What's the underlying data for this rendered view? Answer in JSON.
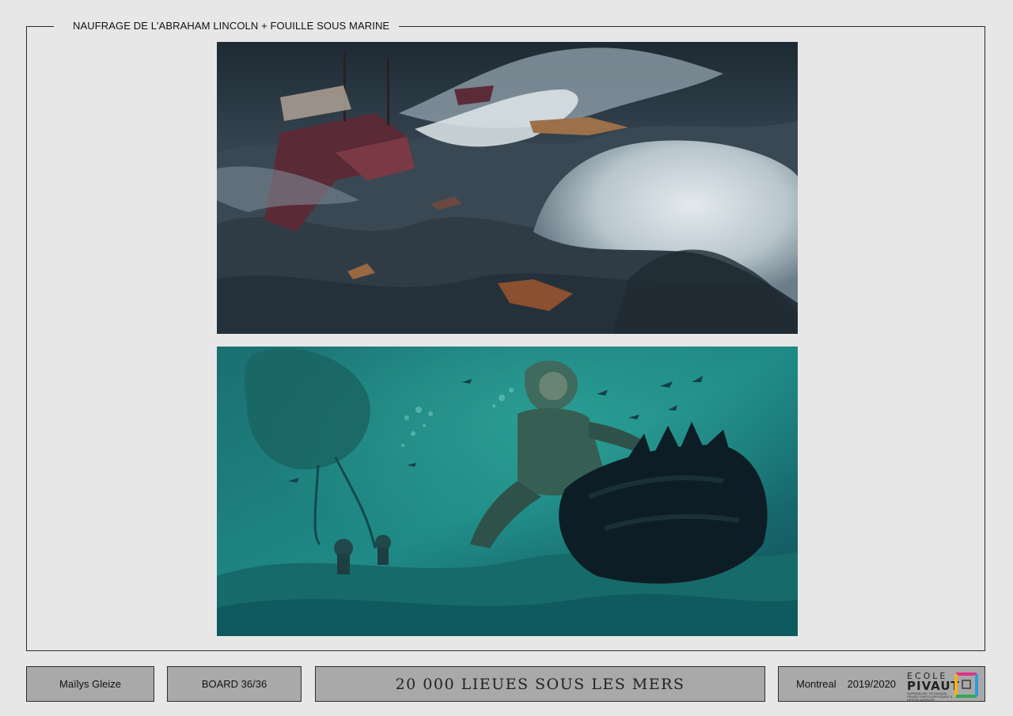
{
  "board": {
    "heading": "NAUFRAGE DE L'ABRAHAM LINCOLN + FOUILLE SOUS MARINE"
  },
  "footer": {
    "author": "Maïlys Gleize",
    "board_number": "BOARD 36/36",
    "project_title": "20 000 LIEUES SOUS LES MERS",
    "city": "Montreal",
    "year": "2019/2020",
    "logo": {
      "line1": "ECOLE",
      "line2": "PIVAUT",
      "tagline": "SUPÉRIEURE TECHNIQUE PRIVÉE D'ARTS APPLIQUÉS & DESSIN NARRATIF"
    }
  },
  "colors": {
    "page_background": "#e7e7e7",
    "footer_box": "#a9a9a9",
    "border": "#2a2a2a",
    "storm_sea": "#2b3540",
    "underwater": "#1f8a86"
  },
  "icons": [
    "logo-square-icon"
  ]
}
